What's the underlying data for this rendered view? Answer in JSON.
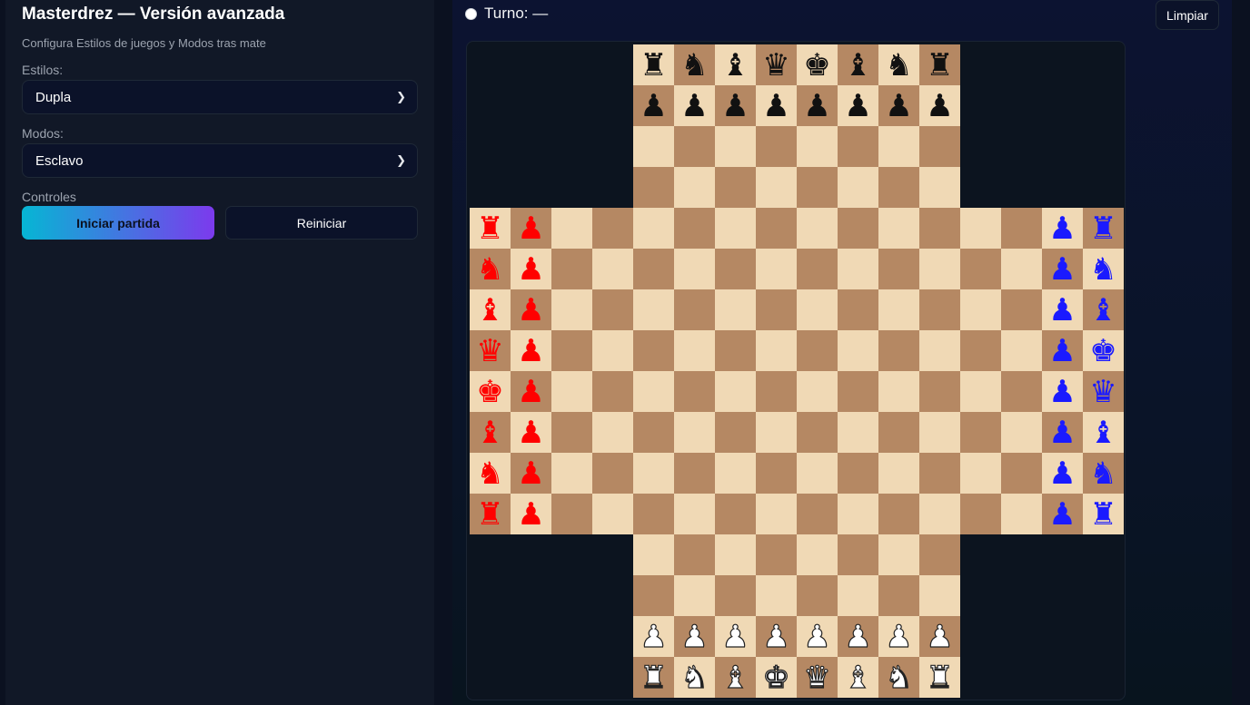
{
  "sidebar": {
    "title": "Masterdrez — Versión avanzada",
    "subtitle": "Configura Estilos de juegos y Modos tras mate",
    "estilos_label": "Estilos:",
    "estilos_value": "Dupla",
    "modos_label": "Modos:",
    "modos_value": "Esclavo",
    "controles_label": "Controles",
    "start_label": "Iniciar partida",
    "reset_label": "Reiniciar"
  },
  "main": {
    "turn_label": "Turno: —",
    "clear_label": "Limpiar"
  },
  "board": {
    "light_color": "#f0d9b5",
    "dark_color": "#b58863",
    "players": {
      "black": {
        "color": "#111111",
        "side": "top",
        "back_rank": [
          "rook",
          "knight",
          "bishop",
          "queen",
          "king",
          "bishop",
          "knight",
          "rook"
        ]
      },
      "white": {
        "color": "#ffffff",
        "side": "bottom",
        "back_rank": [
          "rook",
          "knight",
          "bishop",
          "king",
          "queen",
          "bishop",
          "knight",
          "rook"
        ]
      },
      "red": {
        "color": "#ff0000",
        "side": "left",
        "back_rank": [
          "rook",
          "knight",
          "bishop",
          "queen",
          "king",
          "bishop",
          "knight",
          "rook"
        ]
      },
      "blue": {
        "color": "#1a1aff",
        "side": "right",
        "back_rank": [
          "rook",
          "knight",
          "bishop",
          "king",
          "queen",
          "bishop",
          "knight",
          "rook"
        ]
      }
    }
  }
}
